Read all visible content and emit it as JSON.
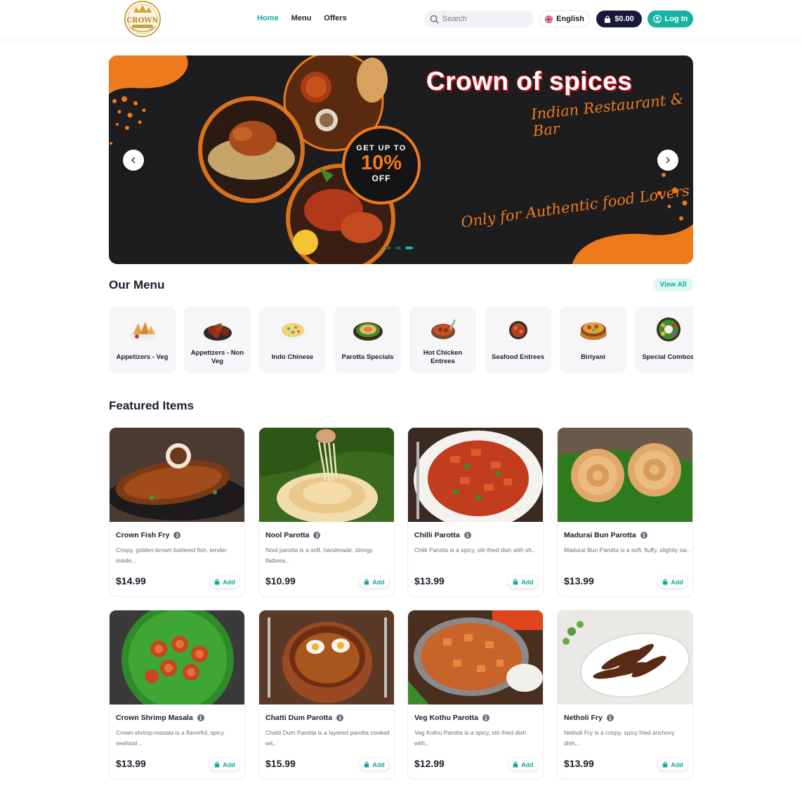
{
  "header": {
    "logo_text": "CROWN",
    "nav": [
      {
        "label": "Home",
        "active": true
      },
      {
        "label": "Menu",
        "active": false
      },
      {
        "label": "Offers",
        "active": false
      }
    ],
    "search_placeholder": "Search",
    "language": "English",
    "cart_total": "$0.00",
    "login_label": "Log In"
  },
  "banner": {
    "title": "Crown of spices",
    "subtitle": "Indian Restaurant & Bar",
    "promo_line1": "GET UP TO",
    "promo_line2": "10%",
    "promo_line3": "OFF",
    "tagline": "Only for Authentic food Lovers",
    "slide_count": 3,
    "active_slide": 3
  },
  "menu_section": {
    "title": "Our Menu",
    "view_all": "View All",
    "categories": [
      {
        "name": "Appetizers - Veg",
        "icon": "samosa-icon"
      },
      {
        "name": "Appetizers - Non Veg",
        "icon": "chicken-icon"
      },
      {
        "name": "Indo Chinese",
        "icon": "fried-rice-icon"
      },
      {
        "name": "Parotta Specials",
        "icon": "parotta-icon"
      },
      {
        "name": "Hot Chicken Entrees",
        "icon": "curry-icon"
      },
      {
        "name": "Seafood Entrees",
        "icon": "seafood-icon"
      },
      {
        "name": "Biriyani",
        "icon": "biriyani-icon"
      },
      {
        "name": "Special Combos",
        "icon": "thali-icon"
      }
    ]
  },
  "featured": {
    "title": "Featured Items",
    "add_label": "Add",
    "items": [
      {
        "name": "Crown Fish Fry",
        "desc": "Crispy, golden-brown battered fish, tender inside,..",
        "price": "$14.99"
      },
      {
        "name": "Nool Parotta",
        "desc": "Nool parotta is a soft, handmade, stringy flatbrea..",
        "price": "$10.99"
      },
      {
        "name": "Chilli Parotta",
        "desc": "Chilli Parotta is a spicy, stir-fried dish with sh..",
        "price": "$13.99"
      },
      {
        "name": "Madurai Bun Parotta",
        "desc": "Madurai Bun Parotta is a soft, fluffy, slightly sw..",
        "price": "$13.99"
      },
      {
        "name": "Crown Shrimp Masala",
        "desc": "Crown shrimp masala is a flavorful, spicy seafood ..",
        "price": "$13.99"
      },
      {
        "name": "Chatti Dum Parotta",
        "desc": "Chatti Dum Parotta is a layered parotta cooked wit..",
        "price": "$15.99"
      },
      {
        "name": "Veg Kothu Parotta",
        "desc": "Veg Kothu Parotta is a spicy, stir-fried dish with..",
        "price": "$12.99"
      },
      {
        "name": "Netholi Fry",
        "desc": "Netholi Fry is a crispy, spicy fried anchovy dish,..",
        "price": "$13.99"
      }
    ]
  },
  "colors": {
    "accent": "#16b2a3",
    "navy": "#17183b",
    "banner_bg": "#1d1c1f",
    "banner_orange": "#f07a1a"
  }
}
